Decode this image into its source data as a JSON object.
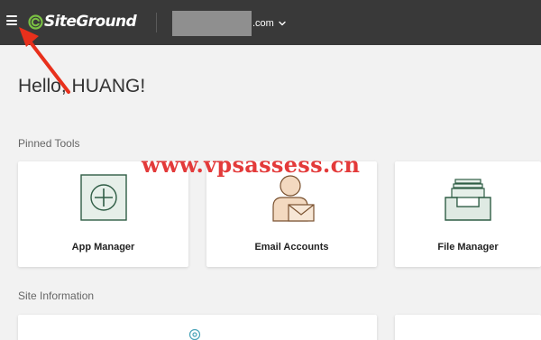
{
  "header": {
    "menu_icon": "hamburger-icon",
    "logo_text": "SiteGround",
    "domain_suffix": ".com",
    "domain_dropdown_icon": "chevron-down-icon"
  },
  "greeting": "Hello, HUANG!",
  "pinned_tools": {
    "title": "Pinned Tools",
    "items": [
      {
        "label": "App Manager",
        "icon": "app-manager-icon"
      },
      {
        "label": "Email Accounts",
        "icon": "email-accounts-icon"
      },
      {
        "label": "File Manager",
        "icon": "file-manager-icon"
      }
    ]
  },
  "site_information": {
    "title": "Site Information"
  },
  "watermark": "www.vpsassess.cn",
  "colors": {
    "topbar": "#393939",
    "brand_green": "#7ac143",
    "icon_green": "#3d7a5c",
    "page_bg": "#f2f2f2",
    "arrow_red": "#e8301c",
    "watermark_red": "#e33a3a"
  }
}
